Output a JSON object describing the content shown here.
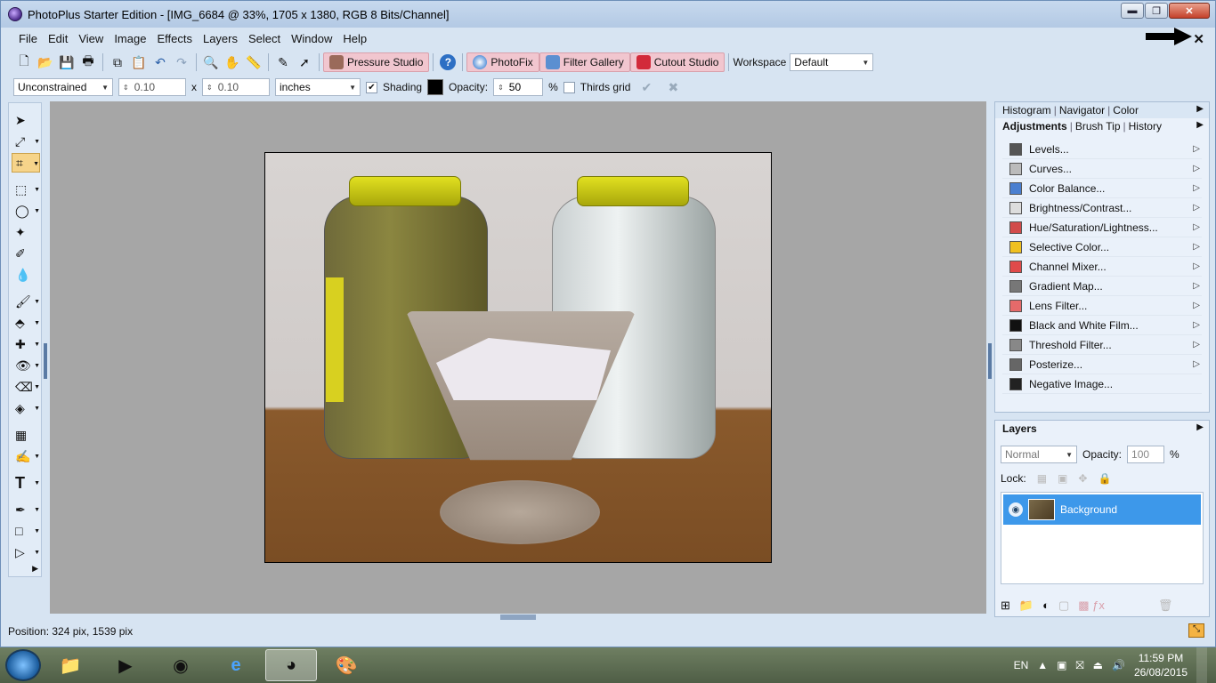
{
  "window": {
    "title": "PhotoPlus Starter Edition - [IMG_6684 @ 33%, 1705 x 1380, RGB 8 Bits/Channel]",
    "buttons": {
      "minimize": "▬",
      "maximize": "❐",
      "close": "✕"
    },
    "doc_close": "✕"
  },
  "menu": [
    "File",
    "Edit",
    "View",
    "Image",
    "Effects",
    "Layers",
    "Select",
    "Window",
    "Help"
  ],
  "toolbar1": {
    "pressure_studio": "Pressure Studio",
    "photofix": "PhotoFix",
    "filter_gallery": "Filter Gallery",
    "cutout_studio": "Cutout Studio",
    "workspace_label": "Workspace",
    "workspace_value": "Default"
  },
  "toolbar2": {
    "constraint": "Unconstrained",
    "width": "0.10",
    "x_sep": "x",
    "height": "0.10",
    "units": "inches",
    "shading_label": "Shading",
    "opacity_label": "Opacity:",
    "opacity_value": "50",
    "percent": "%",
    "thirds_label": "Thirds grid"
  },
  "panels": {
    "top_tabs": [
      "Histogram",
      "Navigator",
      "Color"
    ],
    "adj_tabs": [
      "Adjustments",
      "Brush Tip",
      "History"
    ],
    "adjustments": [
      {
        "label": "Levels...",
        "color": "#555555"
      },
      {
        "label": "Curves...",
        "color": "#bbbbbb"
      },
      {
        "label": "Color Balance...",
        "color": "#4a7fd0"
      },
      {
        "label": "Brightness/Contrast...",
        "color": "#dddddd"
      },
      {
        "label": "Hue/Saturation/Lightness...",
        "color": "#d24b4b"
      },
      {
        "label": "Selective Color...",
        "color": "#f0c020"
      },
      {
        "label": "Channel Mixer...",
        "color": "#e04a4a"
      },
      {
        "label": "Gradient Map...",
        "color": "#777777"
      },
      {
        "label": "Lens Filter...",
        "color": "#e66a6a"
      },
      {
        "label": "Black and White Film...",
        "color": "#111111"
      },
      {
        "label": "Threshold Filter...",
        "color": "#888888"
      },
      {
        "label": "Posterize...",
        "color": "#666666"
      },
      {
        "label": "Negative Image...",
        "color": "#222222"
      }
    ],
    "layers": {
      "title": "Layers",
      "blend_mode": "Normal",
      "opacity_label": "Opacity:",
      "opacity_value": "100",
      "percent": "%",
      "lock_label": "Lock:",
      "layer_name": "Background"
    }
  },
  "status": {
    "position": "Position: 324 pix, 1539 pix"
  },
  "taskbar": {
    "lang": "EN",
    "time": "11:59 PM",
    "date": "26/08/2015"
  }
}
